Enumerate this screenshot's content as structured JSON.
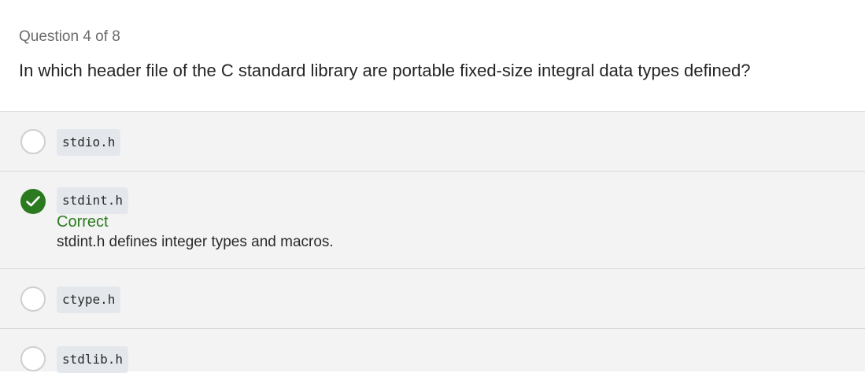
{
  "quiz": {
    "counter": "Question 4 of 8",
    "question": "In which header file of the C standard library are portable fixed-size integral data types defined?"
  },
  "options": [
    {
      "label": "stdio.h",
      "selected": false
    },
    {
      "label": "stdint.h",
      "selected": true,
      "result": "Correct",
      "explanation": "stdint.h defines integer types and macros."
    },
    {
      "label": "ctype.h",
      "selected": false
    },
    {
      "label": "stdlib.h",
      "selected": false
    }
  ],
  "colors": {
    "correct": "#2b7a1f",
    "option_background": "#f3f3f3",
    "code_background": "#e4e8ec"
  },
  "icons": {
    "selected_option": "checkmark-icon"
  }
}
